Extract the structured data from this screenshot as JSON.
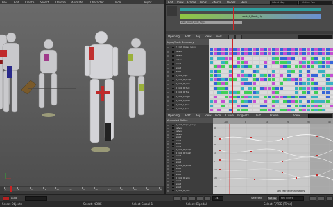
{
  "viewport": {
    "menu": [
      "File",
      "Edit",
      "Create",
      "Select",
      "Deform",
      "Animate",
      "Character",
      "Tools"
    ],
    "view_name": "Right"
  },
  "curve_editor": {
    "menu": [
      "Edit",
      "View",
      "Frame",
      "Tools",
      "Effects",
      "Nodes",
      "Help"
    ],
    "search_placeholder": "Offset Map",
    "right_field": "Action Key",
    "top_clip_label": "walk_4_Rmdr_Up",
    "clip_sub_label": "walk_biped_body_Hips"
  },
  "keyframe_panel": {
    "toolbar": [
      "Opening",
      "Edit",
      "Key",
      "View",
      "Tools"
    ],
    "title": "Input/Node Summary",
    "tree": [
      "E_root_Upper_body",
      "pelvis",
      "pelvis",
      "pelvis",
      "waist",
      "waist",
      "waist",
      "R_root_hips",
      "R_root_R_thigh",
      "R_root_R_shin",
      "R_root_R_foot",
      "R_root_R_Toe",
      "R_root_Lthigh",
      "R_root_L_shin",
      "R_root_L_foot",
      "R_root_L_toe"
    ]
  },
  "graph_panel": {
    "toolbar": [
      "Opening",
      "Edit",
      "Key",
      "View",
      "Tools",
      "Curve",
      "Tangents",
      "List",
      "Frame",
      "View"
    ],
    "title": "Animated Spline",
    "tree": [
      "E_root_Upper_body",
      "pelvis",
      "pelvis",
      "pelvis",
      "waist",
      "waist",
      "waist",
      "waist",
      "R_root_R_thigh",
      "R_root_R_thigh",
      "waist",
      "waist",
      "waist",
      "R_root_R_knee",
      "waist",
      "waist",
      "waist",
      "R_root_R_shin",
      "waist",
      "waist",
      "waist",
      "R_root_R_foot"
    ],
    "y_ticks": [
      "40",
      "30",
      "20",
      "10",
      "0",
      "-10",
      "-20",
      "-30"
    ],
    "x_ticks": [
      "-10",
      "0",
      "10",
      "20",
      "30",
      "40"
    ],
    "mode_label": "Key Marked Parameters"
  },
  "timeline": {
    "frames": [
      "1",
      "5",
      "10",
      "15",
      "20",
      "25",
      "30",
      "35",
      "40",
      "45",
      "50",
      "55",
      "60"
    ],
    "current": "14",
    "end": "60"
  },
  "ctrl": {
    "auto_key": "Auto",
    "sel_label": "Selected",
    "set_key": "Set Key",
    "frame_field": "14",
    "key_filters": "Key Filters"
  },
  "status": {
    "left": "Select Objects",
    "mid1": "Select: NODE",
    "mid2": "Select Global 1",
    "mid3": "Select: Bipedal",
    "right": "Select: T/TBD [Time]"
  },
  "colors": {
    "accent_green": "#3fcf58",
    "accent_magenta": "#c54fd3",
    "accent_blue": "#3565d8",
    "accent_teal": "#38b1c2",
    "accent_red": "#d02424",
    "panel_bg": "#3c3c3c"
  }
}
